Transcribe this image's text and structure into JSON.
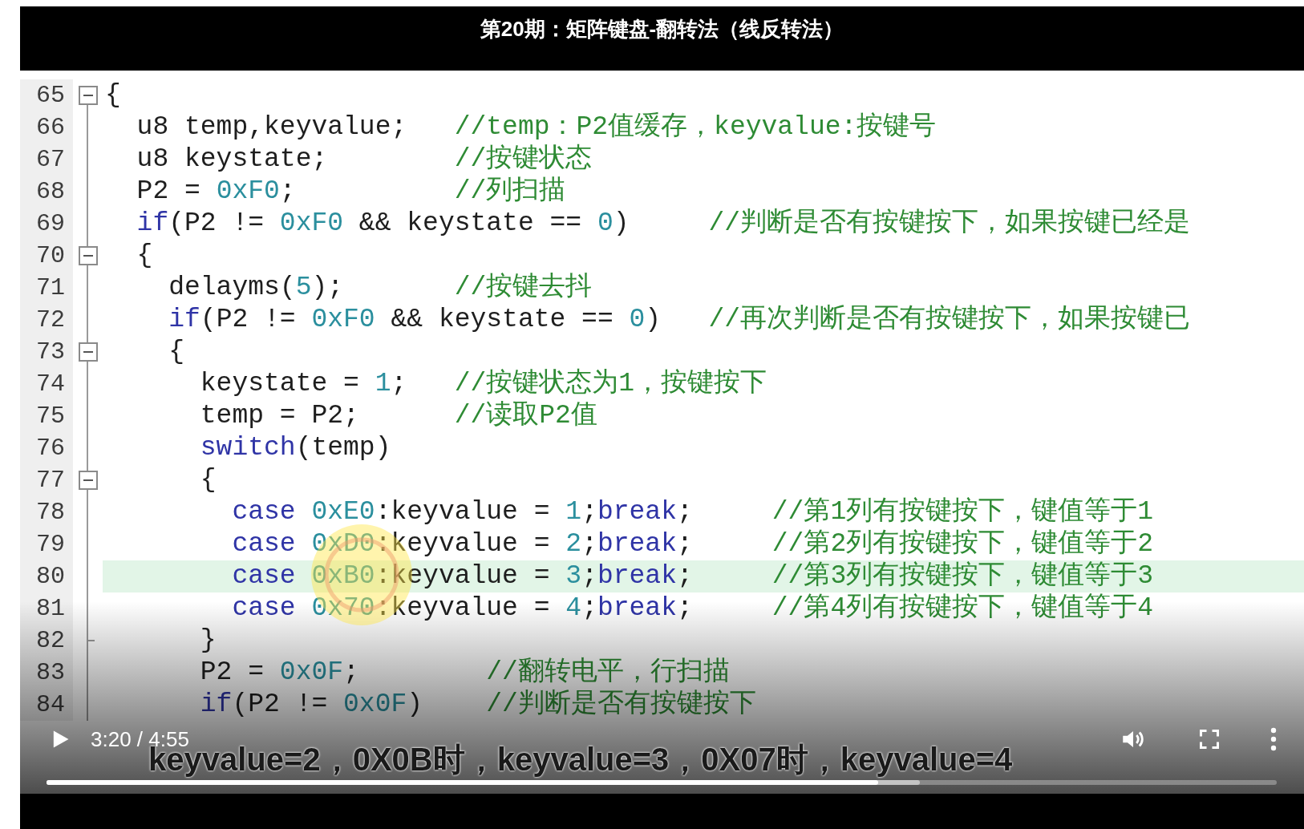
{
  "title": "第20期：矩阵键盘-翻转法（线反转法）",
  "code_editor": {
    "lines": [
      {
        "number": "65",
        "kind": "fold-start",
        "highlighted": false,
        "segments": [
          {
            "kind": "plain",
            "text": "{"
          }
        ]
      },
      {
        "number": "66",
        "kind": "body",
        "highlighted": false,
        "segments": [
          {
            "kind": "plain",
            "text": "  u8 temp,keyvalue;   "
          },
          {
            "kind": "comment",
            "text": "//temp：P2值缓存，keyvalue:按键号"
          }
        ]
      },
      {
        "number": "67",
        "kind": "body",
        "highlighted": false,
        "segments": [
          {
            "kind": "plain",
            "text": "  u8 keystate;        "
          },
          {
            "kind": "comment",
            "text": "//按键状态"
          }
        ]
      },
      {
        "number": "68",
        "kind": "body",
        "highlighted": false,
        "segments": [
          {
            "kind": "plain",
            "text": "  P2 = "
          },
          {
            "kind": "number",
            "text": "0xF0"
          },
          {
            "kind": "plain",
            "text": ";          "
          },
          {
            "kind": "comment",
            "text": "//列扫描"
          }
        ]
      },
      {
        "number": "69",
        "kind": "body",
        "highlighted": false,
        "segments": [
          {
            "kind": "keyword",
            "text": "  if"
          },
          {
            "kind": "plain",
            "text": "(P2 != "
          },
          {
            "kind": "number",
            "text": "0xF0"
          },
          {
            "kind": "plain",
            "text": " && keystate == "
          },
          {
            "kind": "number",
            "text": "0"
          },
          {
            "kind": "plain",
            "text": ")     "
          },
          {
            "kind": "comment",
            "text": "//判断是否有按键按下，如果按键已经是"
          }
        ]
      },
      {
        "number": "70",
        "kind": "fold-start",
        "highlighted": false,
        "segments": [
          {
            "kind": "plain",
            "text": "  {"
          }
        ]
      },
      {
        "number": "71",
        "kind": "body",
        "highlighted": false,
        "segments": [
          {
            "kind": "plain",
            "text": "    delayms("
          },
          {
            "kind": "number",
            "text": "5"
          },
          {
            "kind": "plain",
            "text": ");       "
          },
          {
            "kind": "comment",
            "text": "//按键去抖"
          }
        ]
      },
      {
        "number": "72",
        "kind": "body",
        "highlighted": false,
        "segments": [
          {
            "kind": "keyword",
            "text": "    if"
          },
          {
            "kind": "plain",
            "text": "(P2 != "
          },
          {
            "kind": "number",
            "text": "0xF0"
          },
          {
            "kind": "plain",
            "text": " && keystate == "
          },
          {
            "kind": "number",
            "text": "0"
          },
          {
            "kind": "plain",
            "text": ")   "
          },
          {
            "kind": "comment",
            "text": "//再次判断是否有按键按下，如果按键已"
          }
        ]
      },
      {
        "number": "73",
        "kind": "fold-start",
        "highlighted": false,
        "segments": [
          {
            "kind": "plain",
            "text": "    {"
          }
        ]
      },
      {
        "number": "74",
        "kind": "body",
        "highlighted": false,
        "segments": [
          {
            "kind": "plain",
            "text": "      keystate = "
          },
          {
            "kind": "number",
            "text": "1"
          },
          {
            "kind": "plain",
            "text": ";   "
          },
          {
            "kind": "comment",
            "text": "//按键状态为1，按键按下"
          }
        ]
      },
      {
        "number": "75",
        "kind": "body",
        "highlighted": false,
        "segments": [
          {
            "kind": "plain",
            "text": "      temp = P2;      "
          },
          {
            "kind": "comment",
            "text": "//读取P2值"
          }
        ]
      },
      {
        "number": "76",
        "kind": "body",
        "highlighted": false,
        "segments": [
          {
            "kind": "keyword",
            "text": "      switch"
          },
          {
            "kind": "plain",
            "text": "(temp)"
          }
        ]
      },
      {
        "number": "77",
        "kind": "fold-start",
        "highlighted": false,
        "segments": [
          {
            "kind": "plain",
            "text": "      {"
          }
        ]
      },
      {
        "number": "78",
        "kind": "body",
        "highlighted": false,
        "segments": [
          {
            "kind": "keyword",
            "text": "        case "
          },
          {
            "kind": "number",
            "text": "0xE0"
          },
          {
            "kind": "plain",
            "text": ":keyvalue = "
          },
          {
            "kind": "number",
            "text": "1"
          },
          {
            "kind": "plain",
            "text": ";"
          },
          {
            "kind": "keyword",
            "text": "break"
          },
          {
            "kind": "plain",
            "text": ";     "
          },
          {
            "kind": "comment",
            "text": "//第1列有按键按下，键值等于1"
          }
        ]
      },
      {
        "number": "79",
        "kind": "body",
        "highlighted": false,
        "segments": [
          {
            "kind": "keyword",
            "text": "        case "
          },
          {
            "kind": "number",
            "text": "0xD0"
          },
          {
            "kind": "plain",
            "text": ":keyvalue = "
          },
          {
            "kind": "number",
            "text": "2"
          },
          {
            "kind": "plain",
            "text": ";"
          },
          {
            "kind": "keyword",
            "text": "break"
          },
          {
            "kind": "plain",
            "text": ";     "
          },
          {
            "kind": "comment",
            "text": "//第2列有按键按下，键值等于2"
          }
        ]
      },
      {
        "number": "80",
        "kind": "body",
        "highlighted": true,
        "segments": [
          {
            "kind": "keyword",
            "text": "        case "
          },
          {
            "kind": "number",
            "text": "0xB0"
          },
          {
            "kind": "plain",
            "text": ":keyvalue = "
          },
          {
            "kind": "number",
            "text": "3"
          },
          {
            "kind": "plain",
            "text": ";"
          },
          {
            "kind": "keyword",
            "text": "break"
          },
          {
            "kind": "plain",
            "text": ";     "
          },
          {
            "kind": "comment",
            "text": "//第3列有按键按下，键值等于3"
          }
        ]
      },
      {
        "number": "81",
        "kind": "body",
        "highlighted": false,
        "segments": [
          {
            "kind": "keyword",
            "text": "        case "
          },
          {
            "kind": "number",
            "text": "0x70"
          },
          {
            "kind": "plain",
            "text": ":keyvalue = "
          },
          {
            "kind": "number",
            "text": "4"
          },
          {
            "kind": "plain",
            "text": ";"
          },
          {
            "kind": "keyword",
            "text": "break"
          },
          {
            "kind": "plain",
            "text": ";     "
          },
          {
            "kind": "comment",
            "text": "//第4列有按键按下，键值等于4"
          }
        ]
      },
      {
        "number": "82",
        "kind": "fold-end",
        "highlighted": false,
        "segments": [
          {
            "kind": "plain",
            "text": "      }"
          }
        ]
      },
      {
        "number": "83",
        "kind": "body",
        "highlighted": false,
        "segments": [
          {
            "kind": "plain",
            "text": "      P2 = "
          },
          {
            "kind": "number",
            "text": "0x0F"
          },
          {
            "kind": "plain",
            "text": ";        "
          },
          {
            "kind": "comment",
            "text": "//翻转电平，行扫描"
          }
        ]
      },
      {
        "number": "84",
        "kind": "body",
        "highlighted": false,
        "segments": [
          {
            "kind": "keyword",
            "text": "      if"
          },
          {
            "kind": "plain",
            "text": "(P2 != "
          },
          {
            "kind": "number",
            "text": "0x0F"
          },
          {
            "kind": "plain",
            "text": ")    "
          },
          {
            "kind": "comment",
            "text": "//判断是否有按键按下"
          }
        ]
      }
    ]
  },
  "click_highlight": true,
  "subtitle": "keyvalue=2，0X0B时，keyvalue=3，0X07时，keyvalue=4",
  "controls": {
    "playing": false,
    "time": "3:20 / 4:55",
    "progress": {
      "played": {
        "level": 0.676
      },
      "buffered": {
        "level": 0.71
      }
    }
  }
}
